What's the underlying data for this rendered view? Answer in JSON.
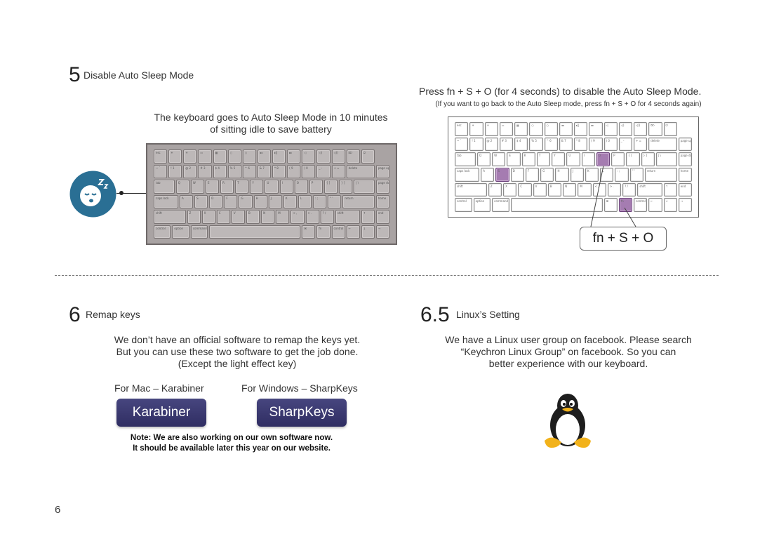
{
  "section5": {
    "number": "5",
    "title": "Disable Auto Sleep Mode",
    "idle_text_line1": "The keyboard goes to Auto Sleep Mode in 10 minutes",
    "idle_text_line2": "of sitting idle to save battery",
    "instruction": "Press fn + S + O (for 4 seconds) to disable the Auto Sleep Mode.",
    "instruction_note": "(If you want to go back to the Auto Sleep mode, press fn + S + O for 4 seconds again)",
    "combo_label": "fn + S + O",
    "sleep_icon": "sleeping-face-icon",
    "colors": {
      "sleep_badge": "#2a6f94",
      "highlight_key": "#a57cb1",
      "keyboard_gray": "#a9a3a3"
    }
  },
  "section6": {
    "number": "6",
    "title": "Remap keys",
    "text_line1": "We don’t have an official software to remap the keys yet.",
    "text_line2": "But you can use these two software to get the job done.",
    "text_line3": "(Except the light effect key)",
    "mac_label": "For Mac – Karabiner",
    "windows_label": "For Windows – SharpKeys",
    "karabiner_button": "Karabiner",
    "sharpkeys_button": "SharpKeys",
    "note_line1": "Note: We are also working on our own software now.",
    "note_line2": "It should be available later this year on our website.",
    "colors": {
      "button": "#3a3970"
    }
  },
  "section65": {
    "number": "6.5",
    "title": "Linux’s Setting",
    "text_line1": "We have a Linux user group on facebook. Please search",
    "text_line2": "“Keychron Linux Group” on facebook. So you can",
    "text_line3": "better experience with our keyboard.",
    "mascot_icon": "penguin-icon"
  },
  "page_number": "6",
  "keyboard": {
    "rows": [
      [
        "esc",
        "☀",
        "☀",
        "▭",
        "▦",
        "○",
        "○",
        "◂◂",
        "▸‖",
        "▸▸",
        "◁",
        "◁)",
        "◁))",
        "⌦",
        "⏻"
      ],
      [
        "~ `",
        "! 1",
        "@ 2",
        "# 3",
        "$ 4",
        "% 5",
        "^ 6",
        "& 7",
        "* 8",
        "( 9",
        ") 0",
        "_ -",
        "+ =",
        "delete",
        "page up"
      ],
      [
        "tab",
        "Q",
        "W",
        "E",
        "R",
        "T",
        "Y",
        "U",
        "I",
        "O",
        "P",
        "{ [",
        "} ]",
        "| \\",
        "page down"
      ],
      [
        "caps lock",
        "A",
        "S",
        "D",
        "F",
        "G",
        "H",
        "J",
        "K",
        "L",
        ": ;",
        "\" '",
        "return",
        "home"
      ],
      [
        "shift",
        "Z",
        "X",
        "C",
        "V",
        "B",
        "N",
        "M",
        "< ,",
        "> .",
        "? /",
        "shift",
        "↑",
        "end"
      ],
      [
        "control",
        "option",
        "command",
        "",
        "⌘",
        "fn",
        "control",
        "←",
        "↓",
        "→"
      ]
    ]
  }
}
